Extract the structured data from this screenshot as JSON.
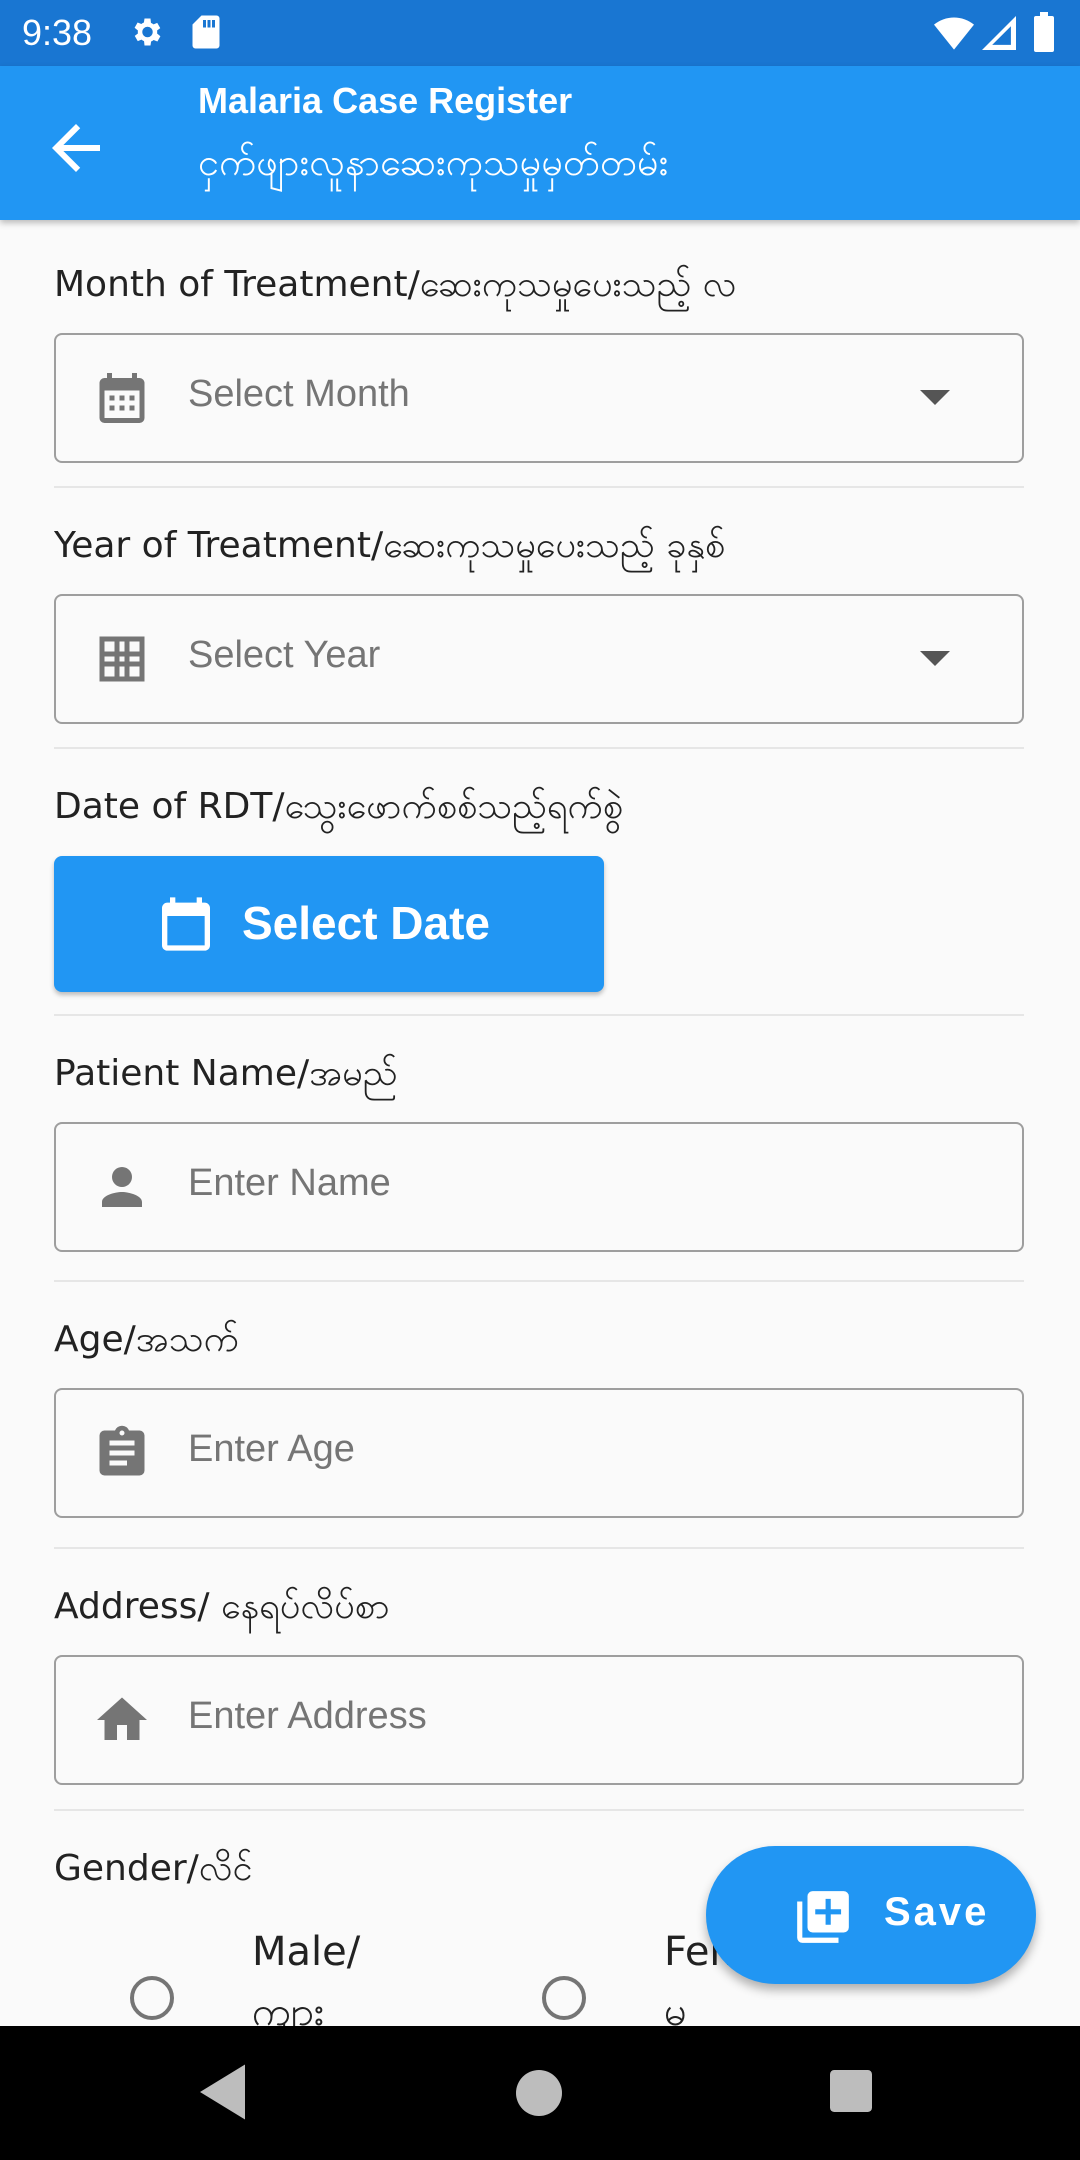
{
  "status_bar": {
    "time": "9:38"
  },
  "app_bar": {
    "title": "Malaria Case Register",
    "subtitle": "ငှက်ဖျားလူနာဆေးကုသမှုမှတ်တမ်း"
  },
  "form": {
    "month": {
      "label": "Month of Treatment/ဆေးကုသမှုပေးသည့် လ",
      "placeholder": "Select Month"
    },
    "year": {
      "label": "Year of Treatment/ဆေးကုသမှုပေးသည့် ခုနှစ်",
      "placeholder": "Select Year"
    },
    "rdt_date": {
      "label": "Date of RDT/သွေးဖောက်စစ်သည့်ရက်စွဲ",
      "button_label": "Select Date"
    },
    "name": {
      "label": "Patient Name/အမည်",
      "placeholder": "Enter Name"
    },
    "age": {
      "label": "Age/အသက်",
      "placeholder": "Enter Age"
    },
    "address": {
      "label": "Address/ နေရပ်လိပ်စာ",
      "placeholder": "Enter Address"
    },
    "gender": {
      "label": "Gender/လိင်",
      "options": [
        {
          "line1": "Male/",
          "line2": "ကျား"
        },
        {
          "line1": "Female/",
          "line2": "မ"
        }
      ]
    }
  },
  "fab": {
    "label": "Save"
  },
  "colors": {
    "primary": "#2196f3",
    "status_bar": "#1976d2",
    "background": "#fafafa"
  },
  "icons": {
    "month": "calendar-month-icon",
    "year": "grid-icon",
    "date": "calendar-icon",
    "name": "person-icon",
    "age": "clipboard-icon",
    "address": "home-icon",
    "save": "add-library-icon"
  }
}
